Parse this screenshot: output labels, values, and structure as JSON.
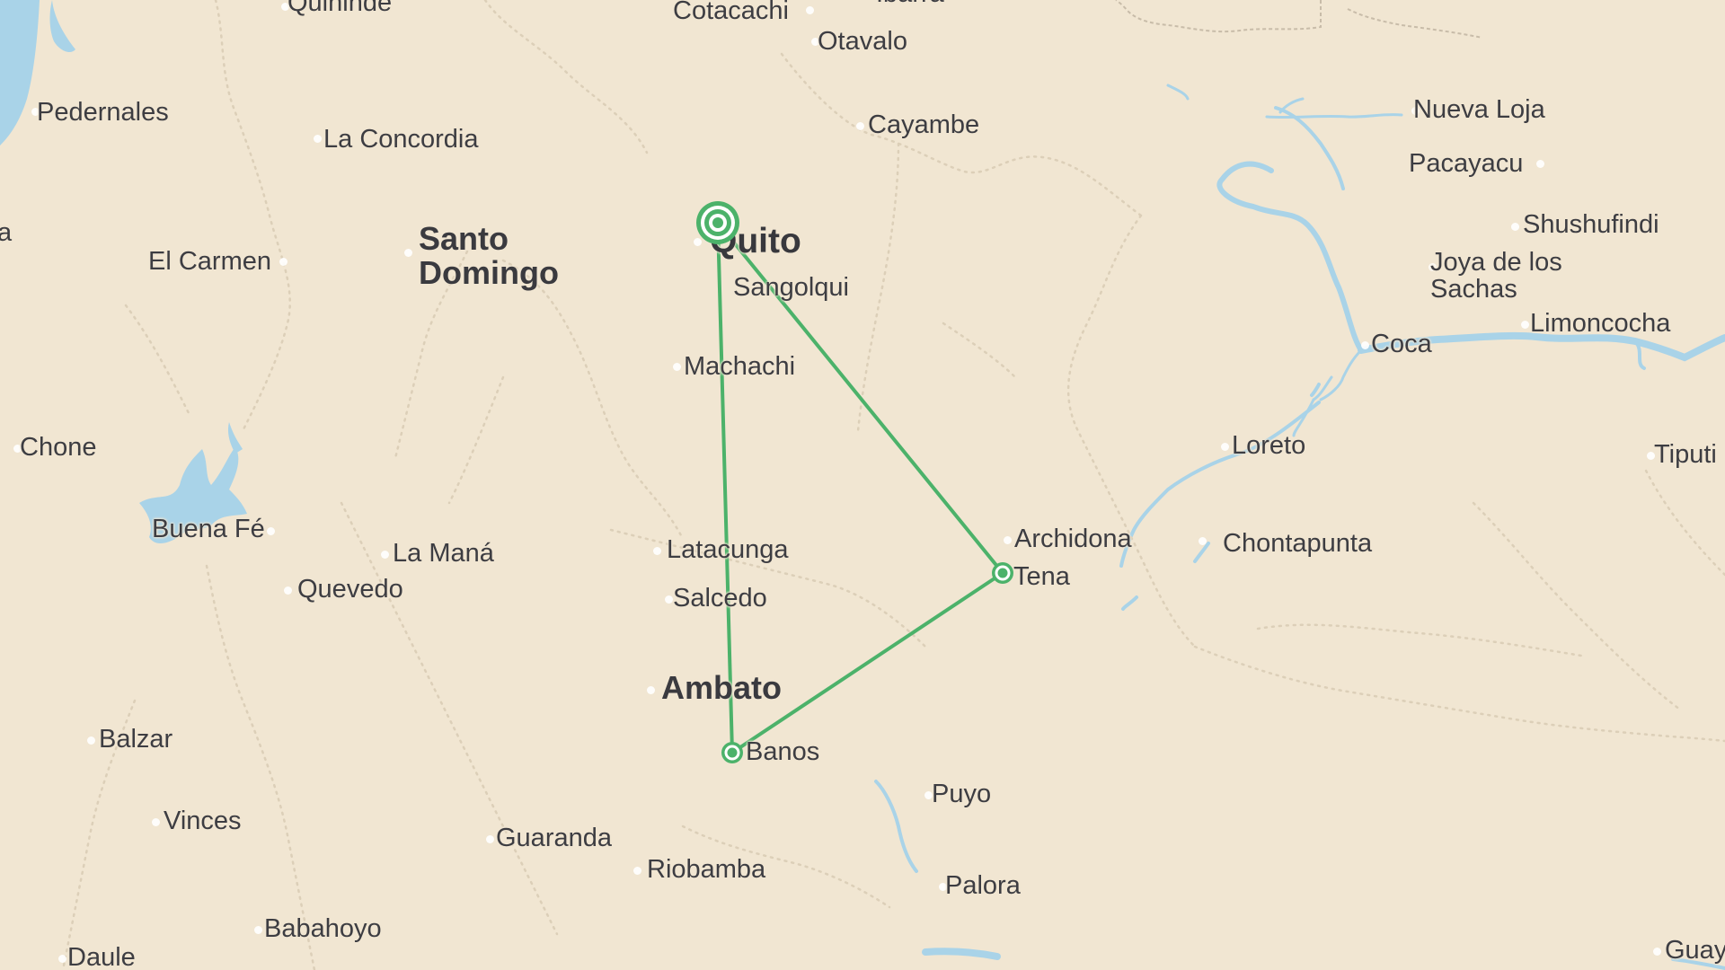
{
  "map": {
    "route_color": "#4cb26a",
    "land_color": "#f1e6d2",
    "water_color": "#a9d3e8",
    "labels": {
      "quininde": "Quininde",
      "cotacachi": "Cotacachi",
      "ibarra": "Ibarra",
      "otavalo": "Otavalo",
      "pedernales": "Pedernales",
      "la_concordia": "La Concordia",
      "cayambe": "Cayambe",
      "nueva_loja": "Nueva Loja",
      "pacayacu": "Pacayacu",
      "santo_domingo": "Santo Domingo",
      "quito": "Quito",
      "el_carmen": "El Carmen",
      "shushufindi": "Shushufindi",
      "joya_de_los_sachas": "Joya de los Sachas",
      "sangolqui": "Sangolqui",
      "limoncocha": "Limoncocha",
      "coca": "Coca",
      "machachi": "Machachi",
      "chone": "Chone",
      "loreto": "Loreto",
      "tiputini": "Tiputi",
      "buena_fe": "Buena Fé",
      "archidona": "Archidona",
      "la_mana": "La Maná",
      "latacunga": "Latacunga",
      "chontapunta": "Chontapunta",
      "tena": "Tena",
      "quevedo": "Quevedo",
      "salcedo": "Salcedo",
      "ambato": "Ambato",
      "balzar": "Balzar",
      "banos": "Banos",
      "puyo": "Puyo",
      "vinces": "Vinces",
      "guaranda": "Guaranda",
      "riobamba": "Riobamba",
      "palora": "Palora",
      "babahoyo": "Babahoyo",
      "daule": "Daule",
      "guayaquil": "Guay",
      "partial_a": "a"
    },
    "route": {
      "stops": [
        "Quito",
        "Tena",
        "Banos",
        "Quito"
      ]
    }
  }
}
